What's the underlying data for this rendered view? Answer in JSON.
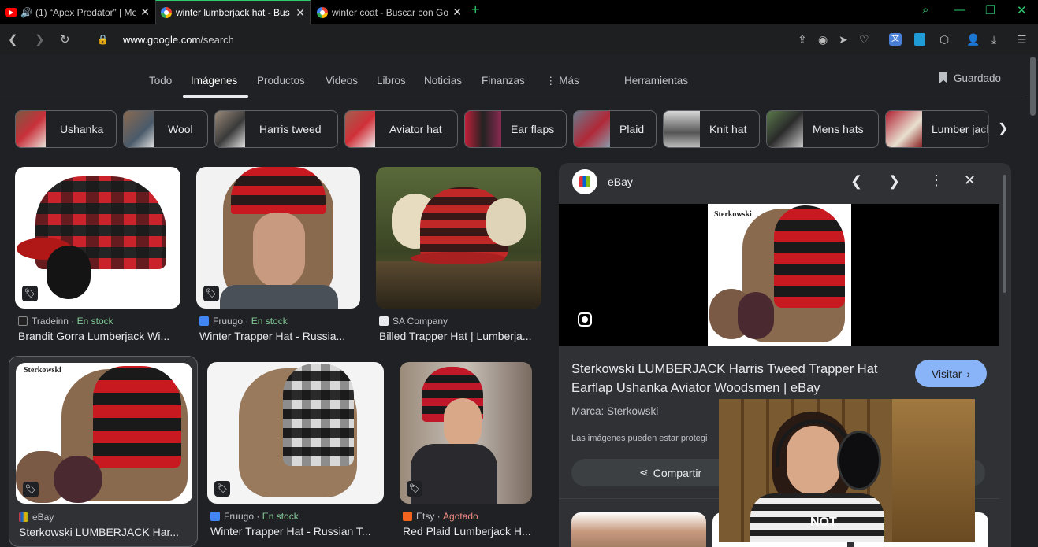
{
  "browser": {
    "tabs": [
      {
        "title": "(1) “Apex Predator” | Me",
        "active": false,
        "icon": "youtube-icon"
      },
      {
        "title": "winter lumberjack hat - Bus",
        "active": true,
        "icon": "google-icon"
      },
      {
        "title": "winter coat - Buscar con Go",
        "active": false,
        "icon": "google-icon"
      }
    ],
    "url_host": "www.google.com",
    "url_path": "/search",
    "accent_color": "#2ecc71"
  },
  "google": {
    "nav_tabs": [
      "Todo",
      "Imágenes",
      "Productos",
      "Videos",
      "Libros",
      "Noticias",
      "Finanzas",
      "Más",
      "Herramientas"
    ],
    "active_tab": "Imágenes",
    "saved_label": "Guardado",
    "chips": [
      "Ushanka",
      "Wool",
      "Harris tweed",
      "Aviator hat",
      "Ear flaps",
      "Plaid",
      "Knit hat",
      "Mens hats",
      "Lumber jack"
    ]
  },
  "results": [
    {
      "source": "Tradeinn",
      "stock": "En stock",
      "title": "Brandit Gorra Lumberjack Wi..."
    },
    {
      "source": "Fruugo",
      "stock": "En stock",
      "title": "Winter Trapper Hat - Russia..."
    },
    {
      "source": "SA Company",
      "stock": "",
      "title": "Billed Trapper Hat | Lumberja..."
    },
    {
      "source": "eBay",
      "stock": "",
      "title": "Sterkowski LUMBERJACK Har..."
    },
    {
      "source": "Fruugo",
      "stock": "En stock",
      "title": "Winter Trapper Hat - Russian T..."
    },
    {
      "source": "Etsy",
      "stock": "Agotado",
      "title": "Red Plaid Lumberjack H..."
    }
  ],
  "panel": {
    "site": "eBay",
    "logo_text": "Sterkowski",
    "title": "Sterkowski LUMBERJACK Harris Tweed Trapper Hat Earflap Ushanka Aviator Woodsmen | eBay",
    "visit_label": "Visitar",
    "brand": "Marca: Sterkowski",
    "notice": "Las imágenes pueden estar protegi",
    "share_label": "Compartir"
  },
  "overlay": {
    "shirt_text": "NOT"
  }
}
